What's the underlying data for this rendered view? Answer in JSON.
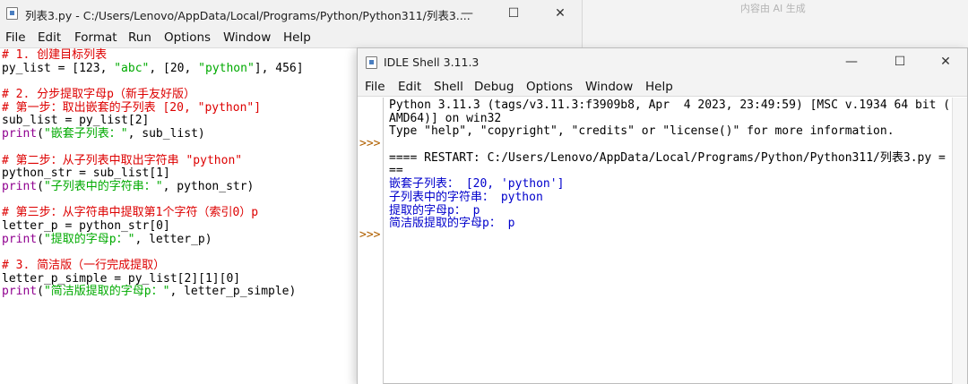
{
  "background": {
    "label": "内容由 AI 生成"
  },
  "editor": {
    "title": "列表3.py - C:/Users/Lenovo/AppData/Local/Programs/Python/Python311/列表3....",
    "menu": [
      "File",
      "Edit",
      "Format",
      "Run",
      "Options",
      "Window",
      "Help"
    ],
    "buttons": {
      "minimize": "—",
      "maximize": "☐",
      "close": "✕"
    },
    "code": [
      [
        {
          "t": "# 1. 创建目标列表",
          "c": "com"
        }
      ],
      [
        {
          "t": "py_list = [123, ",
          "c": ""
        },
        {
          "t": "\"abc\"",
          "c": "str"
        },
        {
          "t": ", [20, ",
          "c": ""
        },
        {
          "t": "\"python\"",
          "c": "str"
        },
        {
          "t": "], 456]",
          "c": ""
        }
      ],
      [
        {
          "t": "",
          "c": ""
        }
      ],
      [
        {
          "t": "# 2. 分步提取字母p（新手友好版）",
          "c": "com"
        }
      ],
      [
        {
          "t": "# 第一步：取出嵌套的子列表 [20, \"python\"]",
          "c": "com"
        }
      ],
      [
        {
          "t": "sub_list = py_list[2]",
          "c": ""
        }
      ],
      [
        {
          "t": "print",
          "c": "kw"
        },
        {
          "t": "(",
          "c": ""
        },
        {
          "t": "\"嵌套子列表：\"",
          "c": "str"
        },
        {
          "t": ", sub_list)",
          "c": ""
        }
      ],
      [
        {
          "t": "",
          "c": ""
        }
      ],
      [
        {
          "t": "# 第二步：从子列表中取出字符串 \"python\"",
          "c": "com"
        }
      ],
      [
        {
          "t": "python_str = sub_list[1]",
          "c": ""
        }
      ],
      [
        {
          "t": "print",
          "c": "kw"
        },
        {
          "t": "(",
          "c": ""
        },
        {
          "t": "\"子列表中的字符串：\"",
          "c": "str"
        },
        {
          "t": ", python_str)",
          "c": ""
        }
      ],
      [
        {
          "t": "",
          "c": ""
        }
      ],
      [
        {
          "t": "# 第三步：从字符串中提取第1个字符（索引0）p",
          "c": "com"
        }
      ],
      [
        {
          "t": "letter_p = python_str[0]",
          "c": ""
        }
      ],
      [
        {
          "t": "print",
          "c": "kw"
        },
        {
          "t": "(",
          "c": ""
        },
        {
          "t": "\"提取的字母p：\"",
          "c": "str"
        },
        {
          "t": ", letter_p)",
          "c": ""
        }
      ],
      [
        {
          "t": "",
          "c": ""
        }
      ],
      [
        {
          "t": "# 3. 简洁版（一行完成提取）",
          "c": "com"
        }
      ],
      [
        {
          "t": "letter_p_simple = py_list[2][1][0]",
          "c": ""
        }
      ],
      [
        {
          "t": "print",
          "c": "kw"
        },
        {
          "t": "(",
          "c": ""
        },
        {
          "t": "\"简洁版提取的字母p：\"",
          "c": "str"
        },
        {
          "t": ", letter_p_simple)",
          "c": ""
        }
      ]
    ]
  },
  "shell": {
    "title": "IDLE Shell 3.11.3",
    "menu": [
      "File",
      "Edit",
      "Shell",
      "Debug",
      "Options",
      "Window",
      "Help"
    ],
    "buttons": {
      "minimize": "—",
      "maximize": "☐",
      "close": "✕"
    },
    "prompt": ">>>",
    "lines": [
      {
        "t": "Python 3.11.3 (tags/v3.11.3:f3909b8, Apr  4 2023, 23:49:59) [MSC v.1934 64 bit (",
        "c": ""
      },
      {
        "t": "AMD64)] on win32",
        "c": ""
      },
      {
        "t": "Type \"help\", \"copyright\", \"credits\" or \"license()\" for more information.",
        "c": ""
      },
      {
        "t": "",
        "c": ""
      },
      {
        "t": "==== RESTART: C:/Users/Lenovo/AppData/Local/Programs/Python/Python311/列表3.py =",
        "c": ""
      },
      {
        "t": "==",
        "c": ""
      },
      {
        "t": "嵌套子列表： [20, 'python']",
        "c": "out"
      },
      {
        "t": "子列表中的字符串： python",
        "c": "out"
      },
      {
        "t": "提取的字母p： p",
        "c": "out"
      },
      {
        "t": "简洁版提取的字母p： p",
        "c": "out"
      }
    ]
  }
}
